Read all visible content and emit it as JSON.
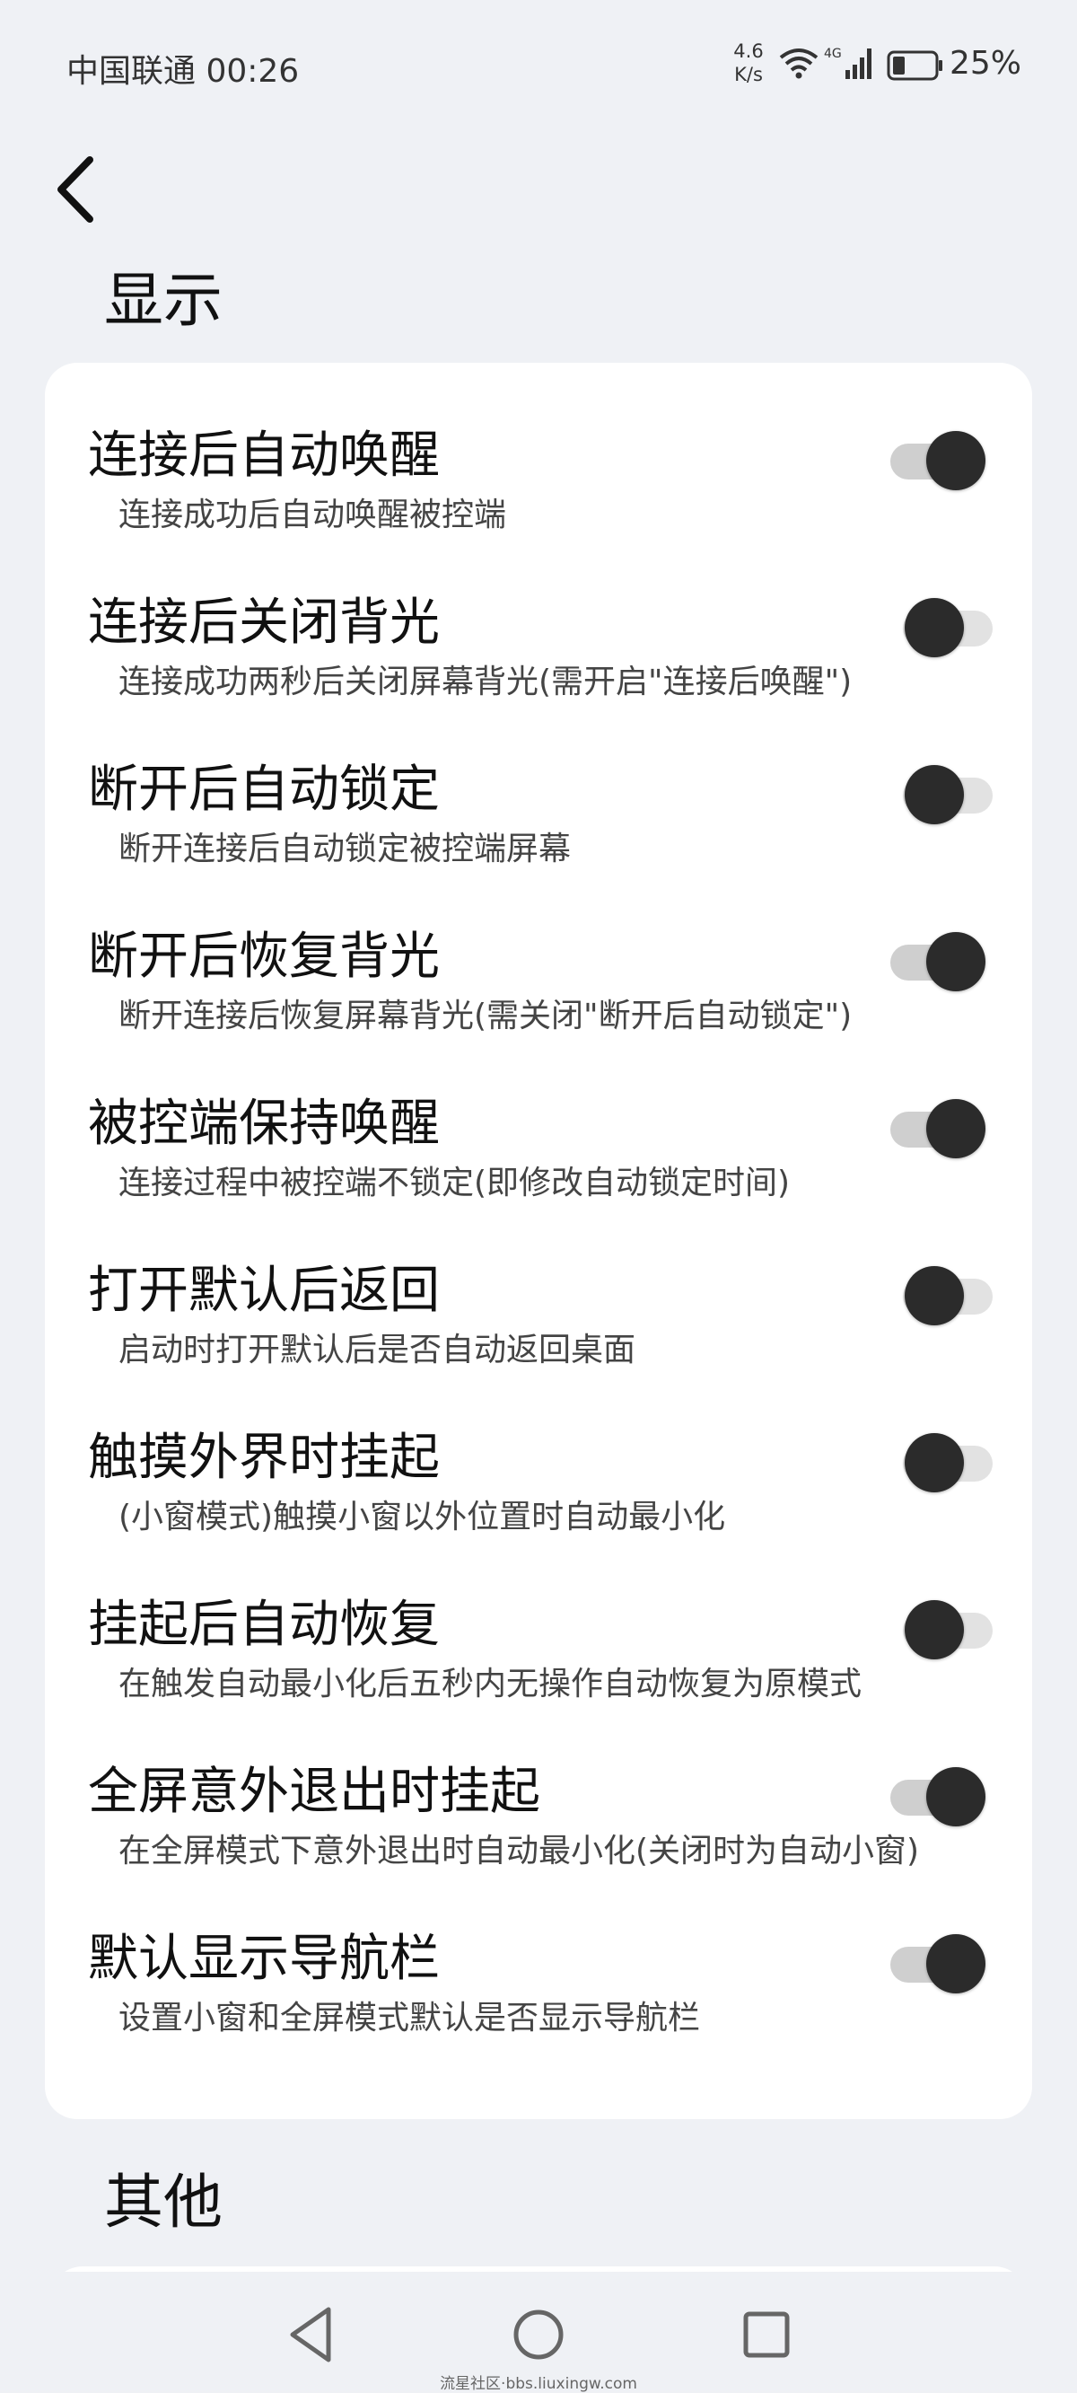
{
  "status_bar": {
    "carrier_time": "中国联通 00:26",
    "net_speed_value": "4.6",
    "net_speed_unit": "K/s",
    "battery": "25%",
    "icons": [
      "wifi-icon",
      "signal-4g-icon",
      "battery-icon"
    ]
  },
  "sections": {
    "display_title": "显示",
    "other_title": "其他"
  },
  "settings": [
    {
      "title": "连接后自动唤醒",
      "subtitle": "连接成功后自动唤醒被控端",
      "enabled": true
    },
    {
      "title": "连接后关闭背光",
      "subtitle": "连接成功两秒后关闭屏幕背光(需开启\"连接后唤醒\")",
      "enabled": false
    },
    {
      "title": "断开后自动锁定",
      "subtitle": "断开连接后自动锁定被控端屏幕",
      "enabled": false
    },
    {
      "title": "断开后恢复背光",
      "subtitle": "断开连接后恢复屏幕背光(需关闭\"断开后自动锁定\")",
      "enabled": true
    },
    {
      "title": "被控端保持唤醒",
      "subtitle": "连接过程中被控端不锁定(即修改自动锁定时间)",
      "enabled": true
    },
    {
      "title": "打开默认后返回",
      "subtitle": "启动时打开默认后是否自动返回桌面",
      "enabled": false
    },
    {
      "title": "触摸外界时挂起",
      "subtitle": "(小窗模式)触摸小窗以外位置时自动最小化",
      "enabled": false
    },
    {
      "title": "挂起后自动恢复",
      "subtitle": "在触发自动最小化后五秒内无操作自动恢复为原模式",
      "enabled": false
    },
    {
      "title": "全屏意外退出时挂起",
      "subtitle": "在全屏模式下意外退出时自动最小化(关闭时为自动小窗)",
      "enabled": true
    },
    {
      "title": "默认显示导航栏",
      "subtitle": "设置小窗和全屏模式默认是否显示导航栏",
      "enabled": true
    }
  ],
  "colors": {
    "background": "#eff1f5",
    "card": "#ffffff",
    "switch_thumb": "#2b2b2b",
    "switch_track": "#d8d8d8"
  },
  "watermark": "流星社区·bbs.liuxingw.com"
}
